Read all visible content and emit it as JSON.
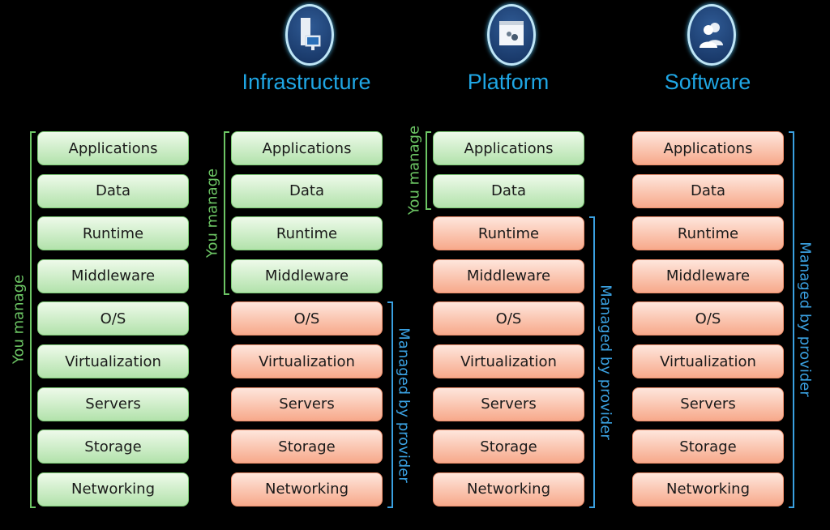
{
  "columns": [
    {
      "title": "",
      "layers": [
        "Applications",
        "Data",
        "Runtime",
        "Middleware",
        "O/S",
        "Virtualization",
        "Servers",
        "Storage",
        "Networking"
      ],
      "you_manage_count": 9
    },
    {
      "title": "Infrastructure",
      "icon": "server-monitor-icon",
      "layers": [
        "Applications",
        "Data",
        "Runtime",
        "Middleware",
        "O/S",
        "Virtualization",
        "Servers",
        "Storage",
        "Networking"
      ],
      "you_manage_count": 4
    },
    {
      "title": "Platform",
      "icon": "app-window-gears-icon",
      "layers": [
        "Applications",
        "Data",
        "Runtime",
        "Middleware",
        "O/S",
        "Virtualization",
        "Servers",
        "Storage",
        "Networking"
      ],
      "you_manage_count": 2
    },
    {
      "title": "Software",
      "icon": "users-icon",
      "layers": [
        "Applications",
        "Data",
        "Runtime",
        "Middleware",
        "O/S",
        "Virtualization",
        "Servers",
        "Storage",
        "Networking"
      ],
      "you_manage_count": 0
    }
  ],
  "labels": {
    "you_manage": "You manage",
    "managed_by_provider": "Managed by provider"
  },
  "colors": {
    "you_manage": "#6cc564",
    "provider": "#3aa0e0",
    "title": "#1fa6e4",
    "green_box": "#b2e2ab",
    "orange_box": "#f7a98b"
  }
}
